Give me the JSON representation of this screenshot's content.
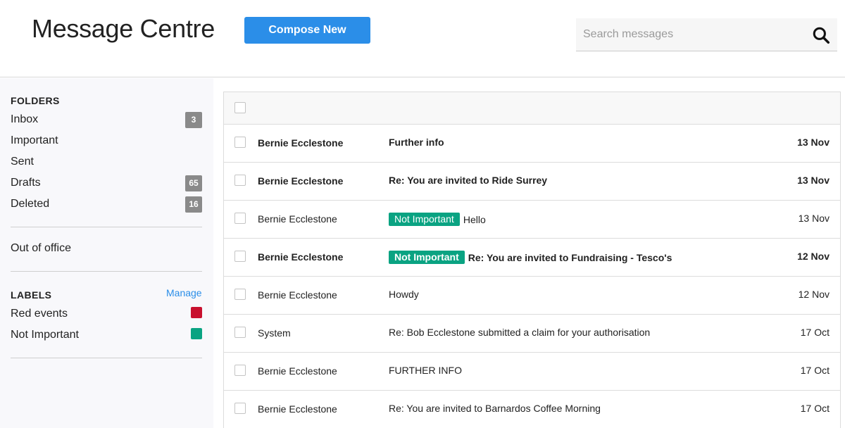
{
  "header": {
    "title": "Message Centre",
    "compose_label": "Compose New",
    "search_placeholder": "Search messages",
    "search_icon": "search-icon"
  },
  "sidebar": {
    "folders_title": "FOLDERS",
    "folders": [
      {
        "label": "Inbox",
        "count": "3"
      },
      {
        "label": "Important",
        "count": null
      },
      {
        "label": "Sent",
        "count": null
      },
      {
        "label": "Drafts",
        "count": "65"
      },
      {
        "label": "Deleted",
        "count": "16"
      }
    ],
    "out_of_office": "Out of office",
    "labels_title": "LABELS",
    "manage_label": "Manage",
    "labels": [
      {
        "label": "Red events",
        "color": "#c8102e"
      },
      {
        "label": "Not Important",
        "color": "#0aa382"
      }
    ]
  },
  "messages": [
    {
      "sender": "Bernie Ecclestone",
      "tag": null,
      "subject": "Further info",
      "date": "13 Nov",
      "unread": true
    },
    {
      "sender": "Bernie Ecclestone",
      "tag": null,
      "subject": "Re: You are invited to Ride Surrey",
      "date": "13 Nov",
      "unread": true
    },
    {
      "sender": "Bernie Ecclestone",
      "tag": "Not Important",
      "subject": "Hello",
      "date": "13 Nov",
      "unread": false
    },
    {
      "sender": "Bernie Ecclestone",
      "tag": "Not Important",
      "subject": "Re: You are invited to Fundraising - Tesco's",
      "date": "12 Nov",
      "unread": true
    },
    {
      "sender": "Bernie Ecclestone",
      "tag": null,
      "subject": "Howdy",
      "date": "12 Nov",
      "unread": false
    },
    {
      "sender": "System",
      "tag": null,
      "subject": "Re: Bob Ecclestone submitted a claim for your authorisation",
      "date": "17 Oct",
      "unread": false
    },
    {
      "sender": "Bernie Ecclestone",
      "tag": null,
      "subject": "FURTHER INFO",
      "date": "17 Oct",
      "unread": false
    },
    {
      "sender": "Bernie Ecclestone",
      "tag": null,
      "subject": "Re: You are invited to Barnardos Coffee Morning",
      "date": "17 Oct",
      "unread": false
    }
  ],
  "colors": {
    "accent": "#2b8ee8",
    "tag_green": "#0aa382",
    "label_red": "#c8102e",
    "badge_grey": "#8a8a8a"
  }
}
